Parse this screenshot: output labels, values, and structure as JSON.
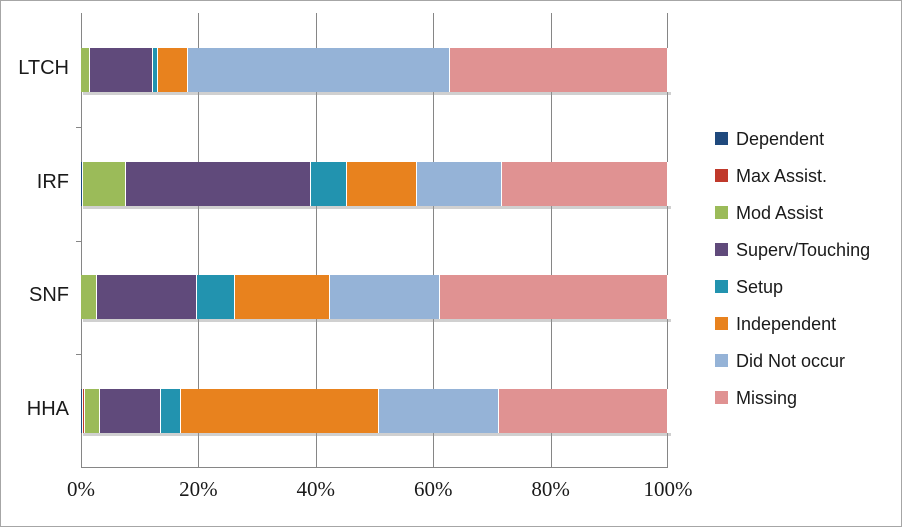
{
  "chart_data": {
    "type": "bar",
    "orientation": "horizontal",
    "stacked": true,
    "stack_mode": "percent",
    "title": "",
    "xlabel": "",
    "ylabel": "",
    "xlim": [
      0,
      100
    ],
    "xticks": [
      0,
      20,
      40,
      60,
      80,
      100
    ],
    "xticklabels": [
      "0%",
      "20%",
      "40%",
      "60%",
      "80%",
      "100%"
    ],
    "grid": true,
    "grid_axis": "x",
    "legend_position": "right",
    "categories": [
      "LTCH",
      "IRF",
      "SNF",
      "HHA"
    ],
    "series": [
      {
        "name": "Dependent",
        "color": "#1F497D",
        "values": [
          0.0,
          0.3,
          0.0,
          0.3
        ]
      },
      {
        "name": "Max Assist.",
        "color": "#C0392B",
        "values": [
          0.0,
          0.0,
          0.0,
          0.4
        ]
      },
      {
        "name": "Mod Assist",
        "color": "#9BBB59",
        "values": [
          1.5,
          7.3,
          2.7,
          2.6
        ]
      },
      {
        "name": "Superv/Touching",
        "color": "#604A7B",
        "values": [
          10.7,
          31.5,
          17.0,
          10.4
        ]
      },
      {
        "name": "Setup",
        "color": "#2293AF",
        "values": [
          1.0,
          6.3,
          6.6,
          3.4
        ]
      },
      {
        "name": "Independent",
        "color": "#E8821E",
        "values": [
          5.1,
          11.8,
          16.2,
          33.7
        ]
      },
      {
        "name": "Did Not occur",
        "color": "#95B3D7",
        "values": [
          44.5,
          14.6,
          18.7,
          20.4
        ]
      },
      {
        "name": "Missing",
        "color": "#E09292",
        "values": [
          37.2,
          28.2,
          38.8,
          28.8
        ]
      }
    ]
  },
  "axis": {
    "category_labels": [
      "LTCH",
      "IRF",
      "SNF",
      "HHA"
    ],
    "tick_labels": [
      "0%",
      "20%",
      "40%",
      "60%",
      "80%",
      "100%"
    ]
  },
  "legend": {
    "items": [
      {
        "label": "Dependent",
        "color": "#1F497D"
      },
      {
        "label": "Max Assist.",
        "color": "#C0392B"
      },
      {
        "label": "Mod Assist",
        "color": "#9BBB59"
      },
      {
        "label": "Superv/Touching",
        "color": "#604A7B"
      },
      {
        "label": "Setup",
        "color": "#2293AF"
      },
      {
        "label": "Independent",
        "color": "#E8821E"
      },
      {
        "label": "Did Not occur",
        "color": "#95B3D7"
      },
      {
        "label": "Missing",
        "color": "#E09292"
      }
    ]
  },
  "colors": {
    "plot_border": "#868686",
    "chart_border": "#a6a6a6",
    "background": "#ffffff",
    "text": "#1a1a1a"
  }
}
